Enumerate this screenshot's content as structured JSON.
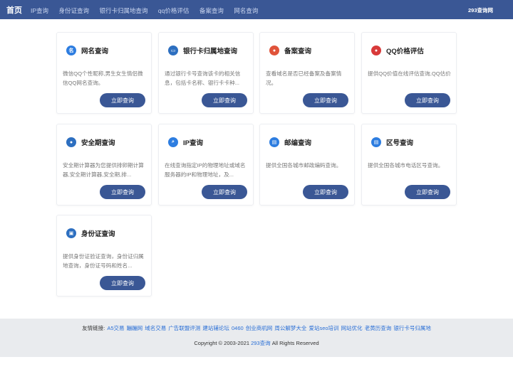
{
  "topbar": {
    "home_label": "首页",
    "nav": [
      "IP查询",
      "身份证查询",
      "银行卡归属地查询",
      "qq价格评估",
      "备案查询",
      "网名查询"
    ],
    "brand": "293查询网"
  },
  "cards": [
    {
      "title": "网名查询",
      "desc": "微信QQ个性昵称,男生女生情侣微信QQ网名查询。",
      "button": "立即查询",
      "icon": "name-icon",
      "icon_glyph": "名",
      "icon_color": "#2d7de0"
    },
    {
      "title": "银行卡归属地查询",
      "desc": "通过银行卡号查询该卡的相关信息，包括卡名称、银行卡卡种...",
      "button": "立即查询",
      "icon": "bank-card-icon",
      "icon_glyph": "▭",
      "icon_color": "#2d6fc0"
    },
    {
      "title": "备案查询",
      "desc": "查看域名是否已经备案及备案情况。",
      "button": "立即查询",
      "icon": "record-search-icon",
      "icon_glyph": "●",
      "icon_color": "#e0533a"
    },
    {
      "title": "QQ价格评估",
      "desc": "提供QQ价值在线评估查询,QQ估价",
      "button": "立即查询",
      "icon": "qq-price-icon",
      "icon_glyph": "●",
      "icon_color": "#d83a3a"
    },
    {
      "title": "安全期查询",
      "desc": "安全期计算器为您提供排卵期计算器,安全期计算器,安全期,排...",
      "button": "立即查询",
      "icon": "safe-period-icon",
      "icon_glyph": "●",
      "icon_color": "#2d6fc0"
    },
    {
      "title": "IP查询",
      "desc": "在线查询指定IP的物理地址或域名服务器的IP和物理地址，及...",
      "button": "立即查询",
      "icon": "ip-search-icon",
      "icon_glyph": "⌕",
      "icon_color": "#2d7de0"
    },
    {
      "title": "邮编查询",
      "desc": "提供全国各城市邮政编码查询。",
      "button": "立即查询",
      "icon": "postcode-icon",
      "icon_glyph": "▤",
      "icon_color": "#2d7de0"
    },
    {
      "title": "区号查询",
      "desc": "提供全国各城市电话区号查询。",
      "button": "立即查询",
      "icon": "area-code-icon",
      "icon_glyph": "▤",
      "icon_color": "#2d7de0"
    },
    {
      "title": "身份证查询",
      "desc": "提供身份证验证查询，身份证归属地查询，身份证号码和姓名...",
      "button": "立即查询",
      "icon": "id-card-icon",
      "icon_glyph": "▣",
      "icon_color": "#2d6fc0"
    }
  ],
  "footer": {
    "links_label": "友情链接:",
    "links": [
      "A5交易",
      "蹦蹦网",
      "域名交易",
      "广告联盟评测",
      "建站辅论坛",
      "0460",
      "创业商机网",
      "周公解梦大全",
      "爱站seo培训",
      "网站优化",
      "老黄历查询",
      "银行卡号归属地"
    ],
    "copyright_prefix": "Copyright © 2003-2021",
    "copyright_link": "293查询",
    "copyright_suffix": "All Rights Reserved"
  }
}
